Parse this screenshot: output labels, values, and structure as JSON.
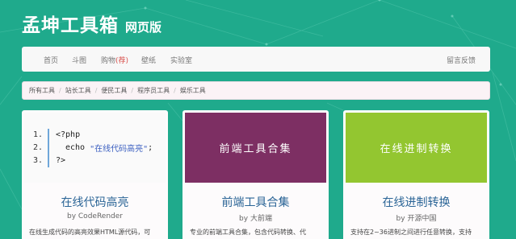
{
  "header": {
    "title": "孟坤工具箱",
    "subtitle": "网页版"
  },
  "nav": {
    "items": [
      {
        "label": "首页"
      },
      {
        "label": "斗图"
      },
      {
        "label": "购物",
        "badge": "(荐)"
      },
      {
        "label": "壁纸"
      },
      {
        "label": "实验室"
      }
    ],
    "feedback": "留言反馈"
  },
  "breadcrumb": [
    "所有工具",
    "站长工具",
    "便民工具",
    "程序员工具",
    "娱乐工具"
  ],
  "cards": [
    {
      "title": "在线代码高亮",
      "author": "by CodeRender",
      "desc": "在线生成代码的高亮效果HTML源代码，可",
      "code": {
        "lines": [
          {
            "num": "1.",
            "text": "<?php"
          },
          {
            "num": "2.",
            "text": "echo ",
            "str": "\"在线代码高亮\"",
            "tail": ";"
          },
          {
            "num": "3.",
            "text": "?>"
          }
        ]
      }
    },
    {
      "title": "前端工具合集",
      "author": "by 大前端",
      "desc": "专业的前端工具合集，包含代码转换、代",
      "media_text": "前端工具合集",
      "media_color": "#7d2f63"
    },
    {
      "title": "在线进制转换",
      "author": "by 开源中国",
      "desc": "支持在2~36进制之间进行任意转换，支持",
      "media_text": "在线进制转换",
      "media_color": "#93c630"
    }
  ],
  "colors": {
    "background": "#1faa8c",
    "link": "#2a6496",
    "badge": "#d9534f"
  }
}
